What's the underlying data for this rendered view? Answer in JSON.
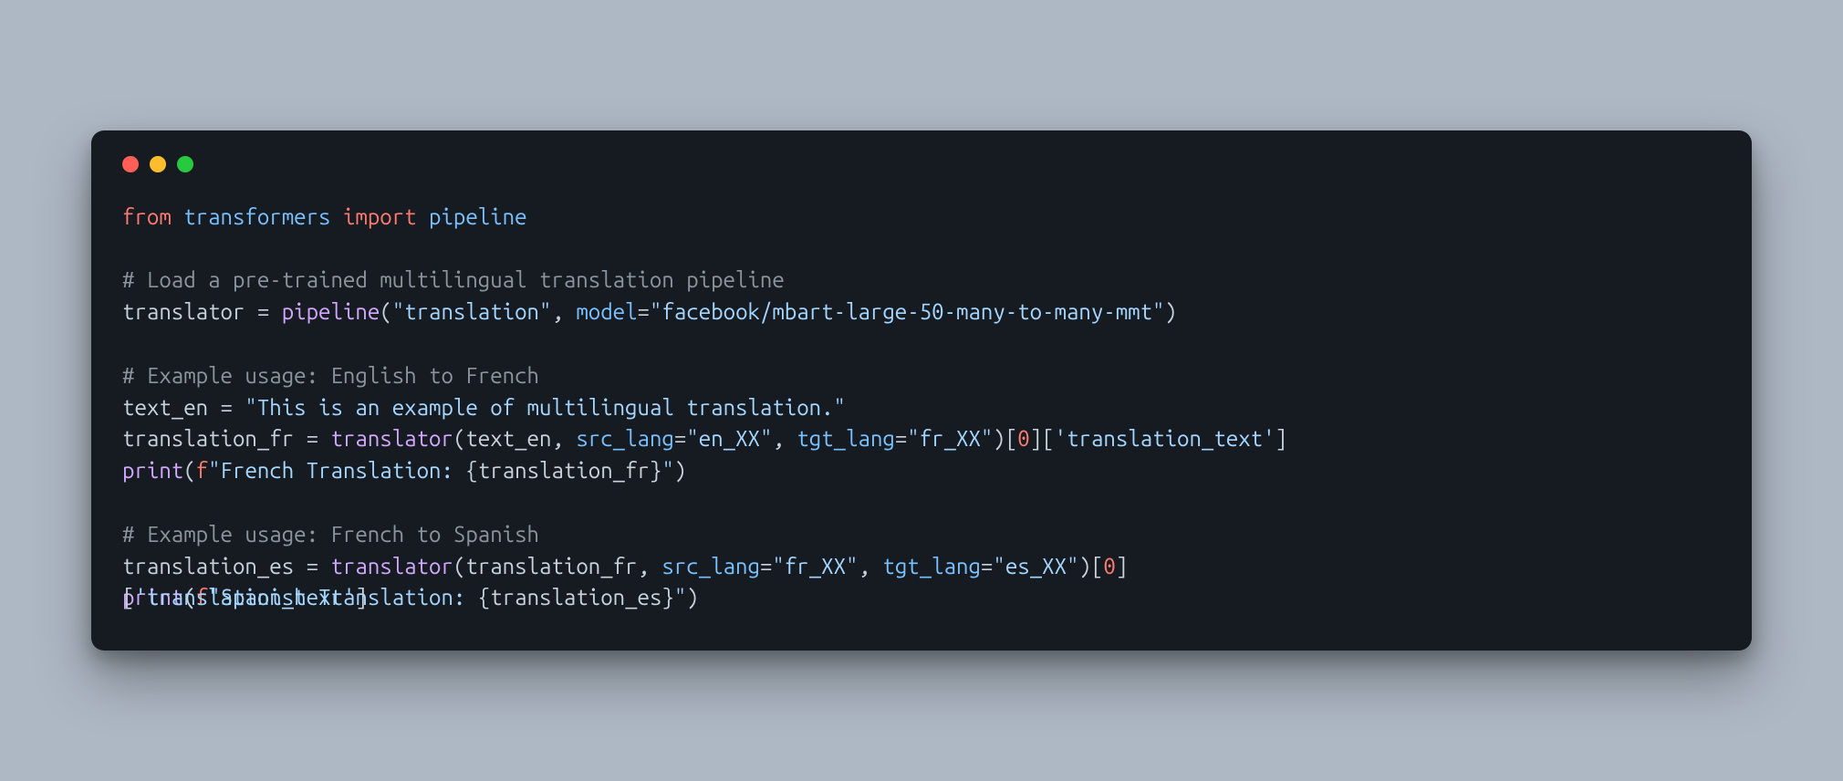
{
  "traffic": {
    "red": "#ff5f56",
    "yellow": "#ffbd2e",
    "green": "#27c93f"
  },
  "code": {
    "l1": {
      "from": "from",
      "transformers": "transformers",
      "import": "import",
      "pipeline": "pipeline"
    },
    "l3": "# Load a pre-trained multilingual translation pipeline",
    "l4": {
      "lhs": "translator",
      "eq": " = ",
      "fn": "pipeline",
      "open": "(",
      "arg1": "\"translation\"",
      "comma": ", ",
      "kw": "model",
      "eq2": "=",
      "arg2": "\"facebook/mbart-large-50-many-to-many-mmt\"",
      "close": ")"
    },
    "l6": "# Example usage: English to French",
    "l7": {
      "lhs": "text_en",
      "eq": " = ",
      "str": "\"This is an example of multilingual translation.\""
    },
    "l8": {
      "lhs": "translation_fr",
      "eq": " = ",
      "fn": "translator",
      "open": "(",
      "a1": "text_en",
      "c1": ", ",
      "kw1": "src_lang",
      "eq1": "=",
      "s1": "\"en_XX\"",
      "c2": ", ",
      "kw2": "tgt_lang",
      "eq2": "=",
      "s2": "\"fr_XX\"",
      "close": ")[",
      "idx": "0",
      "close2": "][",
      "key": "'translation_text'",
      "close3": "]"
    },
    "l9": {
      "fn": "print",
      "open": "(",
      "f": "f",
      "q1": "\"",
      "txt": "French Translation: ",
      "lb": "{",
      "var": "translation_fr",
      "rb": "}",
      "q2": "\"",
      "close": ")"
    },
    "l11": "# Example usage: French to Spanish",
    "l12": {
      "lhs": "translation_es",
      "eq": " = ",
      "fn": "translator",
      "open": "(",
      "a1": "translation_fr",
      "c1": ", ",
      "kw1": "src_lang",
      "eq1": "=",
      "s1": "\"fr_XX\"",
      "c2": ", ",
      "kw2": "tgt_lang",
      "eq2": "=",
      "s2": "\"es_XX\"",
      "close": ")[",
      "idx": "0",
      "close2": "]"
    },
    "l13a": {
      "fn": "print",
      "open": "(",
      "f": "f",
      "q1": "\"",
      "txt": "Spanish Translation: ",
      "lb": "{",
      "var": "translation_es",
      "rb": "}",
      "q2": "\"",
      "close": ")"
    },
    "l13b": {
      "pre": "[",
      "key": "'translation_text'",
      "post": "]"
    }
  }
}
